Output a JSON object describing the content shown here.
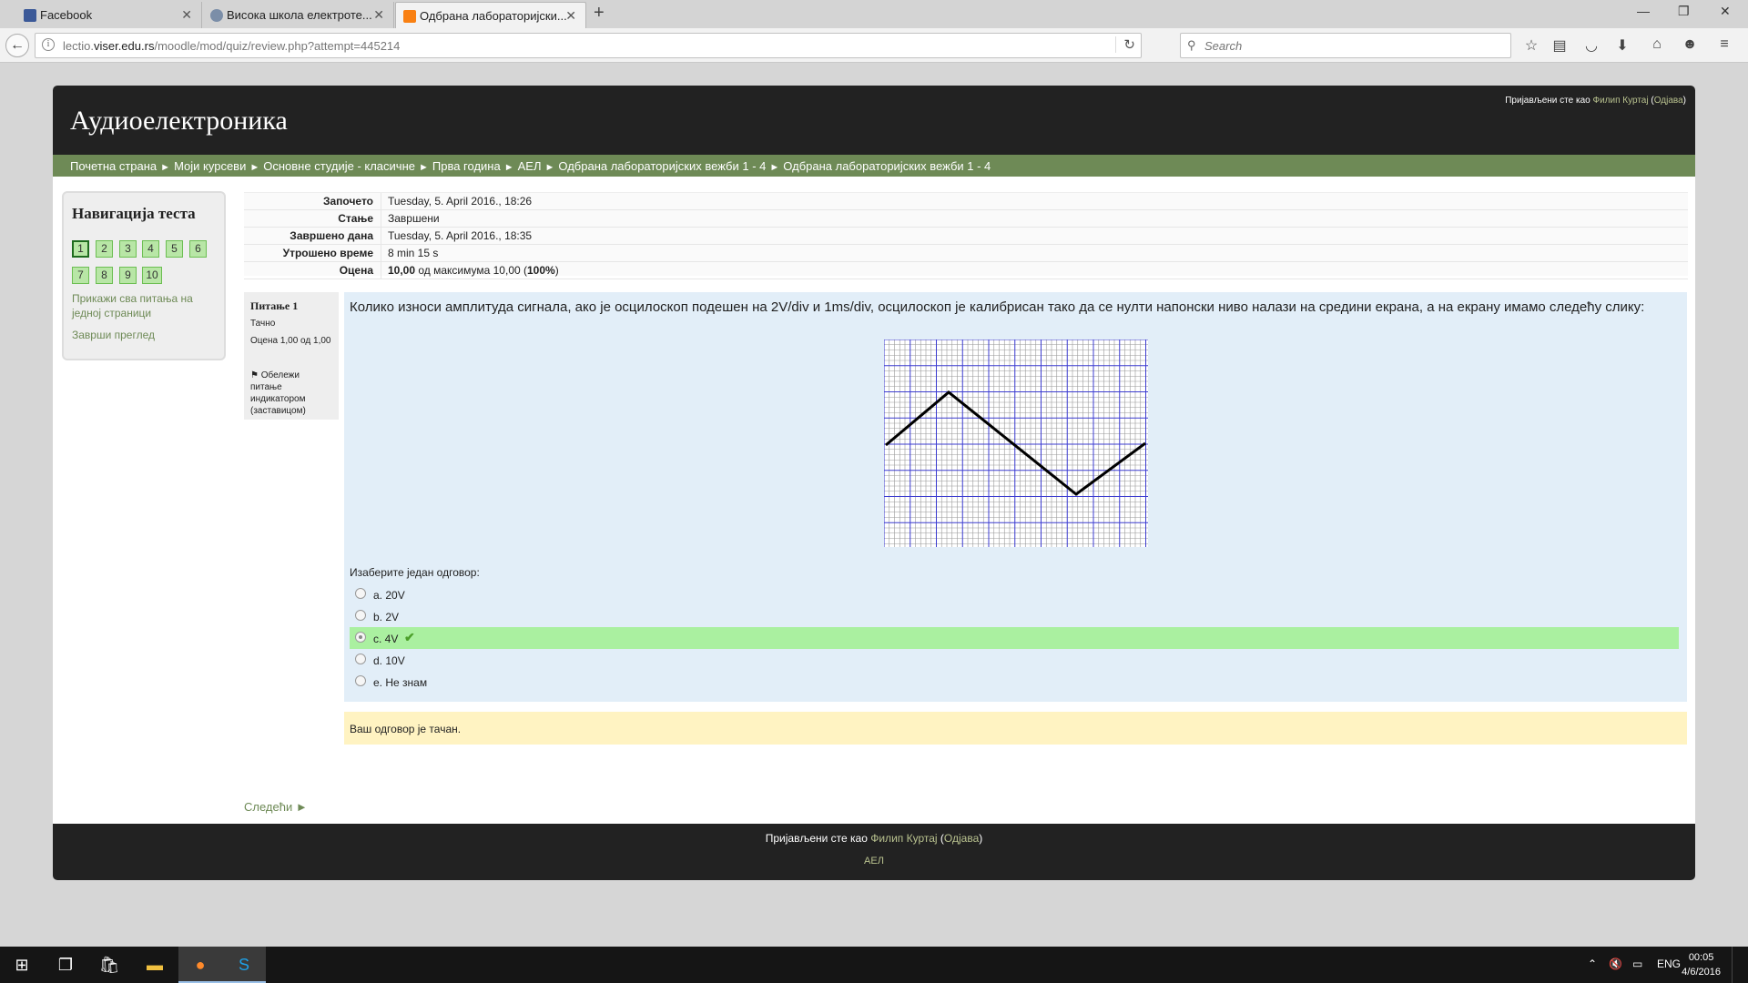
{
  "browser": {
    "tabs": [
      {
        "label": "Facebook",
        "fav": "facebook-icon",
        "color": "#3b5998"
      },
      {
        "label": "Висока школа електроте...",
        "fav": "globe-icon",
        "color": "#7b8ea8"
      },
      {
        "label": "Одбрана лабораторијски...",
        "fav": "moodle-icon",
        "color": "#f98012"
      }
    ],
    "url_prefix": "lectio.",
    "url_domain": "viser.edu.rs",
    "url_path": "/moodle/mod/quiz/review.php?attempt=445214",
    "search_placeholder": "Search"
  },
  "page": {
    "course_title": "Аудиоелектроника",
    "login": {
      "prefix": "Пријављени сте као ",
      "user": "Филип Куртај",
      "open": " (",
      "logout": "Одјава",
      "close": ")"
    },
    "breadcrumbs": [
      "Почетна страна",
      "Моји курсеви",
      "Основне студије - класичне",
      "Прва година",
      "АЕЛ",
      "Одбрана лабораторијских вежби 1 - 4",
      "Одбрана лабораторијских вежби 1 - 4"
    ],
    "breadcrumb_sep": "►",
    "quiz_nav": {
      "title": "Навигација теста",
      "questions": [
        "1",
        "2",
        "3",
        "4",
        "5",
        "6",
        "7",
        "8",
        "9",
        "10"
      ],
      "show_all": "Прикажи сва питања на једној страници",
      "finish": "Заврши преглед"
    },
    "summary": [
      {
        "key": "Започето",
        "value": "Tuesday, 5. April 2016., 18:26"
      },
      {
        "key": "Стање",
        "value": "Завршени"
      },
      {
        "key": "Завршено дана",
        "value": "Tuesday, 5. April 2016., 18:35"
      },
      {
        "key": "Утрошено време",
        "value": "8 min 15 s"
      },
      {
        "key": "Оцена",
        "value_bold": "10,00",
        "value_mid": " од максимума 10,00 (",
        "value_pct": "100%",
        "value_end": ")"
      }
    ],
    "question_info": {
      "number_label": "Питање",
      "number": "1",
      "state": "Тачно",
      "grade": "Оцена 1,00 од 1,00",
      "flag": "Обележи питање индикатором (заставицом)"
    },
    "question": {
      "text": "Колико износи амплитуда сигнала, ако је осцилоскоп подешен на 2V/div и 1ms/div, осцилоскоп је калибрисан тако да се нулти напонски ниво налази на средини екрана, а на екрану имамо следећу слику:",
      "prompt": "Изаберите један одговор:",
      "answers": [
        {
          "label": "a. 20V",
          "selected": false,
          "correct": false
        },
        {
          "label": "b. 2V",
          "selected": false,
          "correct": false
        },
        {
          "label": "c. 4V",
          "selected": true,
          "correct": true
        },
        {
          "label": "d. 10V",
          "selected": false,
          "correct": false
        },
        {
          "label": "e. Не знам",
          "selected": false,
          "correct": false
        }
      ],
      "correct_mark": "✔",
      "feedback": "Ваш одговор је тачан."
    },
    "next_link": "Следећи ►",
    "footer": {
      "prefix": "Пријављени сте као ",
      "user": "Филип Куртај",
      "open": " (",
      "logout": "Одјава",
      "close": ")",
      "course_link": "АЕЛ"
    }
  },
  "taskbar": {
    "language": "ENG",
    "time": "00:05",
    "date": "4/6/2016"
  },
  "colors": {
    "header_bg": "#222222",
    "breadcrumb_bg": "#6e8a56",
    "link": "#b9c28f",
    "question_bg": "#e2eef8",
    "correct_bg": "#aaf0a0",
    "feedback_bg": "#fff3c2"
  }
}
